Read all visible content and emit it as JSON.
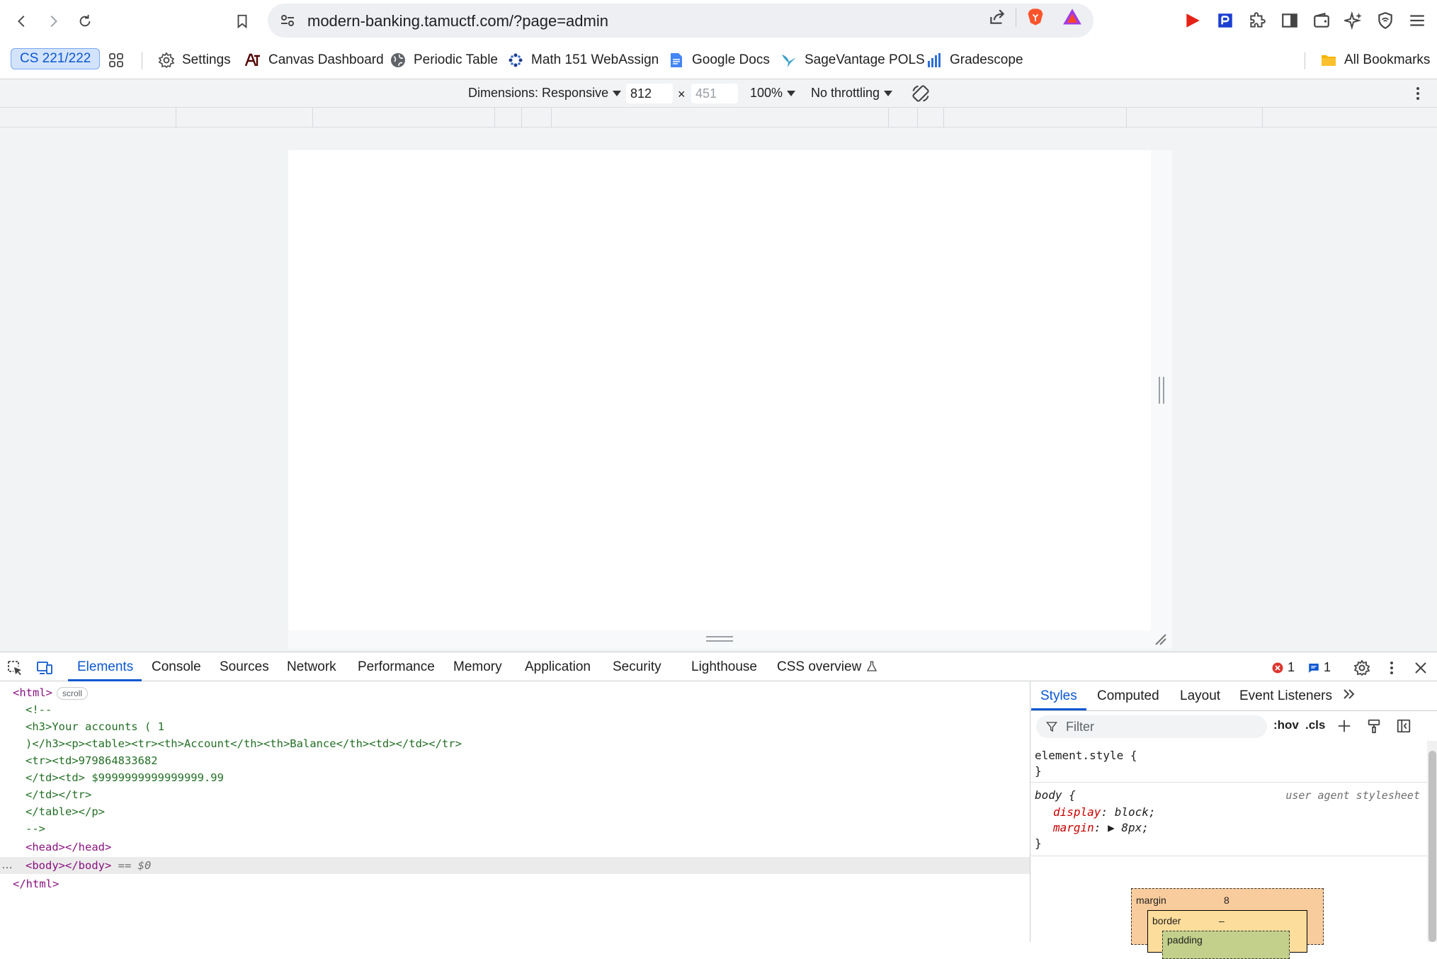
{
  "browser": {
    "url": "modern-banking.tamuctf.com/?page=admin"
  },
  "bookmarks": {
    "profile_chip": "CS 221/222",
    "items": [
      {
        "label": "Settings"
      },
      {
        "label": "Canvas Dashboard"
      },
      {
        "label": "Periodic Table"
      },
      {
        "label": "Math 151 WebAssign"
      },
      {
        "label": "Google Docs"
      },
      {
        "label": "SageVantage POLS"
      },
      {
        "label": "Gradescope"
      }
    ],
    "all_bookmarks": "All Bookmarks"
  },
  "device_toolbar": {
    "dimensions": "Dimensions: Responsive",
    "width": "812",
    "times": "×",
    "height": "451",
    "zoom": "100%",
    "throttling": "No throttling"
  },
  "devtools": {
    "tabs": [
      "Elements",
      "Console",
      "Sources",
      "Network",
      "Performance",
      "Memory",
      "Application",
      "Security",
      "Lighthouse",
      "CSS overview"
    ],
    "active_tab": "Elements",
    "errors": "1",
    "messages": "1"
  },
  "elements_tree": {
    "html_open": "<html>",
    "scroll_badge": "scroll",
    "lines": [
      "<!--",
      "<h3>Your accounts ( 1",
      ")</h3><p><table><tr><th>Account</th><th>Balance</th><td></td></tr>",
      "<tr><td>979864833682",
      "</td><td> $9999999999999999.99",
      "</td></tr>",
      "</table></p>",
      "-->"
    ],
    "head": "<head></head>",
    "body": "<body></body>",
    "body_marker": "== $0",
    "dots": "…",
    "html_close": "</html>"
  },
  "styles_pane": {
    "tabs": [
      "Styles",
      "Computed",
      "Layout",
      "Event Listeners"
    ],
    "filter_placeholder": "Filter",
    "hov": ":hov",
    "cls": ".cls",
    "element_style_open": "element.style {",
    "close_brace": "}",
    "body_rule_open": "body {",
    "source": "user agent stylesheet",
    "display_prop": "display",
    "display_val": "block;",
    "margin_prop": "margin",
    "margin_val": "8px;",
    "box_margin_label": "margin",
    "box_margin_value": "8",
    "box_border_label": "border",
    "box_border_value": "–",
    "box_padding_label": "padding"
  }
}
